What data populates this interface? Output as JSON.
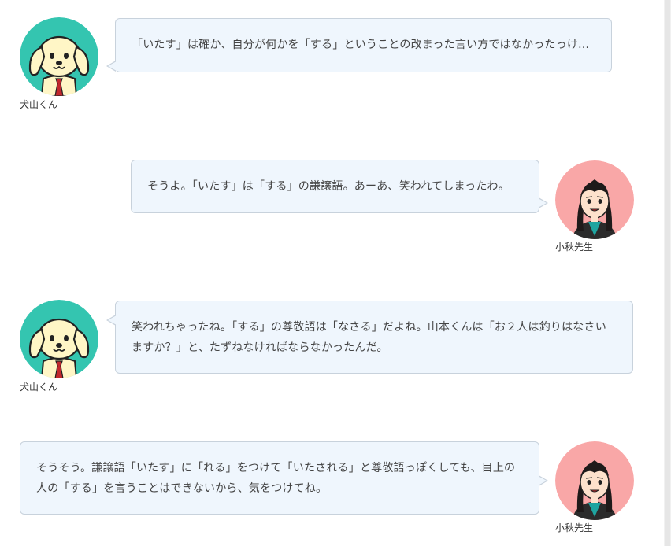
{
  "colors": {
    "dog_avatar_bg": "#34c5b0",
    "teacher_avatar_bg": "#f9a7a7",
    "bubble_bg": "#eff6fd",
    "bubble_border": "#c8d2dc"
  },
  "messages": [
    {
      "speaker": "犬山くん",
      "avatar_icon": "dog-character-icon",
      "side": "left",
      "text": "「いたす」は確か、自分が何かを「する」ということの改まった言い方ではなかったっけ…"
    },
    {
      "speaker": "小秋先生",
      "avatar_icon": "teacher-character-icon",
      "side": "right",
      "text": "そうよ。「いたす」は「する」の謙譲語。あーあ、笑われてしまったわ。"
    },
    {
      "speaker": "犬山くん",
      "avatar_icon": "dog-character-icon",
      "side": "left",
      "text": "笑われちゃったね。「する」の尊敬語は「なさる」だよね。山本くんは「お２人は釣りはなさいますか？」と、たずねなければならなかったんだ。"
    },
    {
      "speaker": "小秋先生",
      "avatar_icon": "teacher-character-icon",
      "side": "right",
      "text": "そうそう。謙譲語「いたす」に「れる」をつけて「いたされる」と尊敬語っぽくしても、目上の人の「する」を言うことはできないから、気をつけてね。"
    }
  ]
}
